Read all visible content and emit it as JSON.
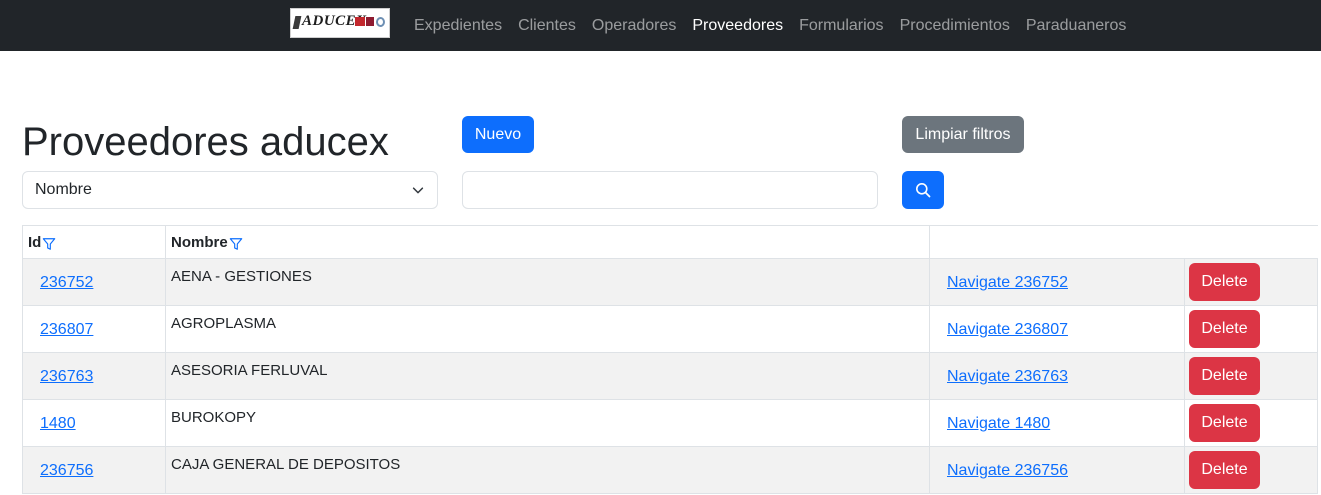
{
  "navbar": {
    "brand": "ADUCEX",
    "links": [
      {
        "label": "Expedientes"
      },
      {
        "label": "Clientes"
      },
      {
        "label": "Operadores"
      },
      {
        "label": "Proveedores",
        "active": true
      },
      {
        "label": "Formularios"
      },
      {
        "label": "Procedimientos"
      },
      {
        "label": "Paraduaneros"
      }
    ]
  },
  "page": {
    "title": "Proveedores aducex",
    "new_label": "Nuevo",
    "clear_label": "Limpiar filtros",
    "filter_field": {
      "selected": "Nombre"
    },
    "search": {
      "value": "",
      "placeholder": ""
    }
  },
  "table": {
    "headers": {
      "id": "Id",
      "name": "Nombre"
    },
    "rows": [
      {
        "id": "236752",
        "name": "AENA - GESTIONES",
        "navigate": "Navigate 236752",
        "delete": "Delete"
      },
      {
        "id": "236807",
        "name": "AGROPLASMA",
        "navigate": "Navigate 236807",
        "delete": "Delete"
      },
      {
        "id": "236763",
        "name": "ASESORIA FERLUVAL",
        "navigate": "Navigate 236763",
        "delete": "Delete"
      },
      {
        "id": "1480",
        "name": "BUROKOPY",
        "navigate": "Navigate 1480",
        "delete": "Delete"
      },
      {
        "id": "236756",
        "name": "CAJA GENERAL DE DEPOSITOS",
        "navigate": "Navigate 236756",
        "delete": "Delete"
      }
    ]
  },
  "colors": {
    "navbar_bg": "#212529",
    "primary": "#0d6efd",
    "secondary": "#6c757d",
    "danger": "#dc3545",
    "stripe": "#f2f2f2"
  }
}
